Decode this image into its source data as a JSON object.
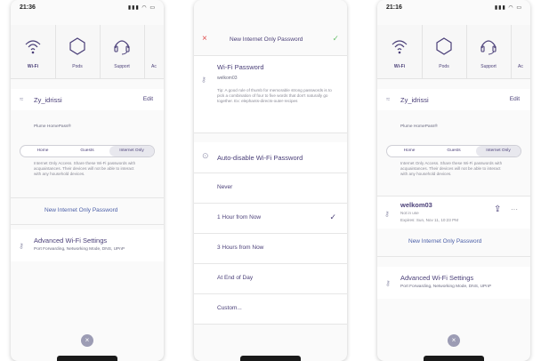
{
  "screen1": {
    "time": "21:36",
    "tabs": [
      "Wi-Fi",
      "Pods",
      "Support",
      "Ac"
    ],
    "network": "Zy_idrissi",
    "edit": "Edit",
    "homepass": "Plume HomePass®",
    "segments": [
      "Home",
      "Guests",
      "Internet Only"
    ],
    "access_text": "Internet Only Access. Share these Wi-Fi passwords with acquaintances. Their devices will not be able to interact with any household devices.",
    "new_password": "New Internet Only Password",
    "adv_title": "Advanced Wi-Fi Settings",
    "adv_sub": "Port Forwarding, Networking Mode, DNS, UPnP"
  },
  "screen2": {
    "title": "New Internet Only Password",
    "pw_label": "Wi-Fi Password",
    "pw_value": "welkom03",
    "tip": "Tip: A good rule of thumb for memorable strong passwords is to pick a combination of four to five words that don't naturally go together. Ex: elephants-directs-outer-recipes",
    "auto_disable": "Auto-disable Wi-Fi Password",
    "options": [
      "Never",
      "1 Hour from Now",
      "3 Hours from Now",
      "At End of Day",
      "Custom..."
    ],
    "selected_index": 1
  },
  "screen3": {
    "time": "21:16",
    "tabs": [
      "Wi-Fi",
      "Pods",
      "Support",
      "Ac"
    ],
    "network": "Zy_idrissi",
    "edit": "Edit",
    "homepass": "Plume HomePass®",
    "segments": [
      "Home",
      "Guests",
      "Internet Only"
    ],
    "access_text": "Internet Only Access. Share these Wi-Fi passwords with acquaintances. Their devices will not be able to interact with any household devices.",
    "pw_name": "welkom03",
    "pw_status": "Not in use",
    "pw_expires": "Expires: Sun, Nov 11, 10:23 PM",
    "more": "···",
    "new_password": "New Internet Only Password",
    "adv_title": "Advanced Wi-Fi Settings",
    "adv_sub": "Port Forwarding, Networking Mode, DNS, UPnP"
  },
  "icons": {
    "wifi": "wifi-icon",
    "pods": "hexagon-icon",
    "support": "headset-icon",
    "key": "key-icon",
    "close": "close-icon",
    "check": "check-icon",
    "share": "share-icon",
    "timer": "timer-icon"
  },
  "colors": {
    "text": "#4a3f78",
    "link": "#4b5fa8",
    "close": "#e05050",
    "check": "#6cc070"
  }
}
